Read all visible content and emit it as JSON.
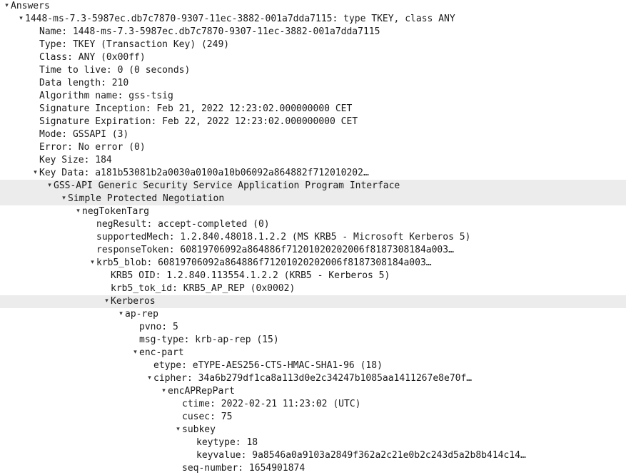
{
  "view": {
    "name": "packet-details-tree",
    "background_color": "#ffffff",
    "text_color": "#1a1a1a",
    "selection_color": "#ececec",
    "caret_expanded_glyph": "▾"
  },
  "rows": [
    {
      "indent": 0,
      "caret": "expanded",
      "selected": false,
      "text": "Answers"
    },
    {
      "indent": 1,
      "caret": "expanded",
      "selected": false,
      "text": "1448-ms-7.3-5987ec.db7c7870-9307-11ec-3882-001a7dda7115: type TKEY, class ANY"
    },
    {
      "indent": 2,
      "caret": "none",
      "selected": false,
      "text": "Name: 1448-ms-7.3-5987ec.db7c7870-9307-11ec-3882-001a7dda7115"
    },
    {
      "indent": 2,
      "caret": "none",
      "selected": false,
      "text": "Type: TKEY (Transaction Key) (249)"
    },
    {
      "indent": 2,
      "caret": "none",
      "selected": false,
      "text": "Class: ANY (0x00ff)"
    },
    {
      "indent": 2,
      "caret": "none",
      "selected": false,
      "text": "Time to live: 0 (0 seconds)"
    },
    {
      "indent": 2,
      "caret": "none",
      "selected": false,
      "text": "Data length: 210"
    },
    {
      "indent": 2,
      "caret": "none",
      "selected": false,
      "text": "Algorithm name: gss-tsig"
    },
    {
      "indent": 2,
      "caret": "none",
      "selected": false,
      "text": "Signature Inception: Feb 21, 2022 12:23:02.000000000 CET"
    },
    {
      "indent": 2,
      "caret": "none",
      "selected": false,
      "text": "Signature Expiration: Feb 22, 2022 12:23:02.000000000 CET"
    },
    {
      "indent": 2,
      "caret": "none",
      "selected": false,
      "text": "Mode: GSSAPI (3)"
    },
    {
      "indent": 2,
      "caret": "none",
      "selected": false,
      "text": "Error: No error (0)"
    },
    {
      "indent": 2,
      "caret": "none",
      "selected": false,
      "text": "Key Size: 184"
    },
    {
      "indent": 2,
      "caret": "expanded",
      "selected": false,
      "text": "Key Data: a181b53081b2a0030a0100a10b06092a864882f712010202…"
    },
    {
      "indent": 3,
      "caret": "expanded",
      "selected": true,
      "text": "GSS-API Generic Security Service Application Program Interface"
    },
    {
      "indent": 4,
      "caret": "expanded",
      "selected": true,
      "text": "Simple Protected Negotiation"
    },
    {
      "indent": 5,
      "caret": "expanded",
      "selected": false,
      "text": "negTokenTarg"
    },
    {
      "indent": 6,
      "caret": "none",
      "selected": false,
      "text": "negResult: accept-completed (0)"
    },
    {
      "indent": 6,
      "caret": "none",
      "selected": false,
      "text": "supportedMech: 1.2.840.48018.1.2.2 (MS KRB5 - Microsoft Kerberos 5)"
    },
    {
      "indent": 6,
      "caret": "none",
      "selected": false,
      "text": "responseToken: 60819706092a864886f71201020202006f8187308184a003…"
    },
    {
      "indent": 6,
      "caret": "expanded",
      "selected": false,
      "text": "krb5_blob: 60819706092a864886f71201020202006f8187308184a003…"
    },
    {
      "indent": 7,
      "caret": "none",
      "selected": false,
      "text": "KRB5 OID: 1.2.840.113554.1.2.2 (KRB5 - Kerberos 5)"
    },
    {
      "indent": 7,
      "caret": "none",
      "selected": false,
      "text": "krb5_tok_id: KRB5_AP_REP (0x0002)"
    },
    {
      "indent": 7,
      "caret": "expanded",
      "selected": true,
      "text": "Kerberos"
    },
    {
      "indent": 8,
      "caret": "expanded",
      "selected": false,
      "text": "ap-rep"
    },
    {
      "indent": 9,
      "caret": "none",
      "selected": false,
      "text": "pvno: 5"
    },
    {
      "indent": 9,
      "caret": "none",
      "selected": false,
      "text": "msg-type: krb-ap-rep (15)"
    },
    {
      "indent": 9,
      "caret": "expanded",
      "selected": false,
      "text": "enc-part"
    },
    {
      "indent": 10,
      "caret": "none",
      "selected": false,
      "text": "etype: eTYPE-AES256-CTS-HMAC-SHA1-96 (18)"
    },
    {
      "indent": 10,
      "caret": "expanded",
      "selected": false,
      "text": "cipher: 34a6b279df1ca8a113d0e2c34247b1085aa1411267e8e70f…"
    },
    {
      "indent": 11,
      "caret": "expanded",
      "selected": false,
      "text": "encAPRepPart"
    },
    {
      "indent": 12,
      "caret": "none",
      "selected": false,
      "text": "ctime: 2022-02-21 11:23:02 (UTC)"
    },
    {
      "indent": 12,
      "caret": "none",
      "selected": false,
      "text": "cusec: 75"
    },
    {
      "indent": 12,
      "caret": "expanded",
      "selected": false,
      "text": "subkey"
    },
    {
      "indent": 13,
      "caret": "none",
      "selected": false,
      "text": "keytype: 18"
    },
    {
      "indent": 13,
      "caret": "none",
      "selected": false,
      "text": "keyvalue: 9a8546a0a9103a2849f362a2c21e0b2c243d5a2b8b414c14…"
    },
    {
      "indent": 12,
      "caret": "none",
      "selected": false,
      "text": "seq-number: 1654901874"
    }
  ]
}
